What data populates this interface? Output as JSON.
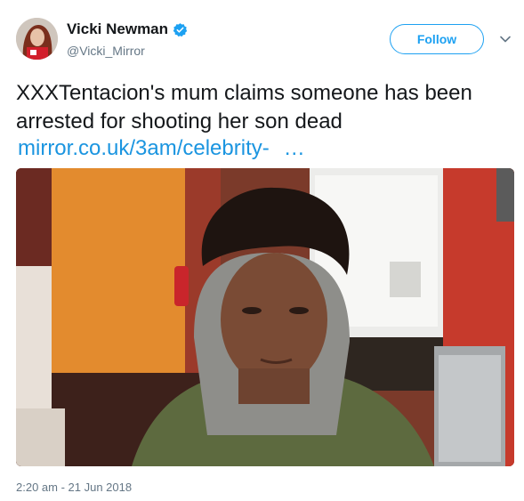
{
  "author": {
    "display_name": "Vicki Newman",
    "handle": "@Vicki_Mirror",
    "verified": true
  },
  "actions": {
    "follow_label": "Follow"
  },
  "tweet": {
    "text": "XXXTentacion's mum claims someone has been arrested for shooting her son dead",
    "link_text": "mirror.co.uk/3am/celebrity-",
    "link_ellipsis": "…",
    "timestamp": "2:20 am - 21 Jun 2018"
  },
  "colors": {
    "accent": "#1da1f2",
    "link": "#1b95e0",
    "secondary_text": "#657786"
  },
  "icons": {
    "verified": "verified-badge-icon",
    "caret": "chevron-down-icon"
  }
}
